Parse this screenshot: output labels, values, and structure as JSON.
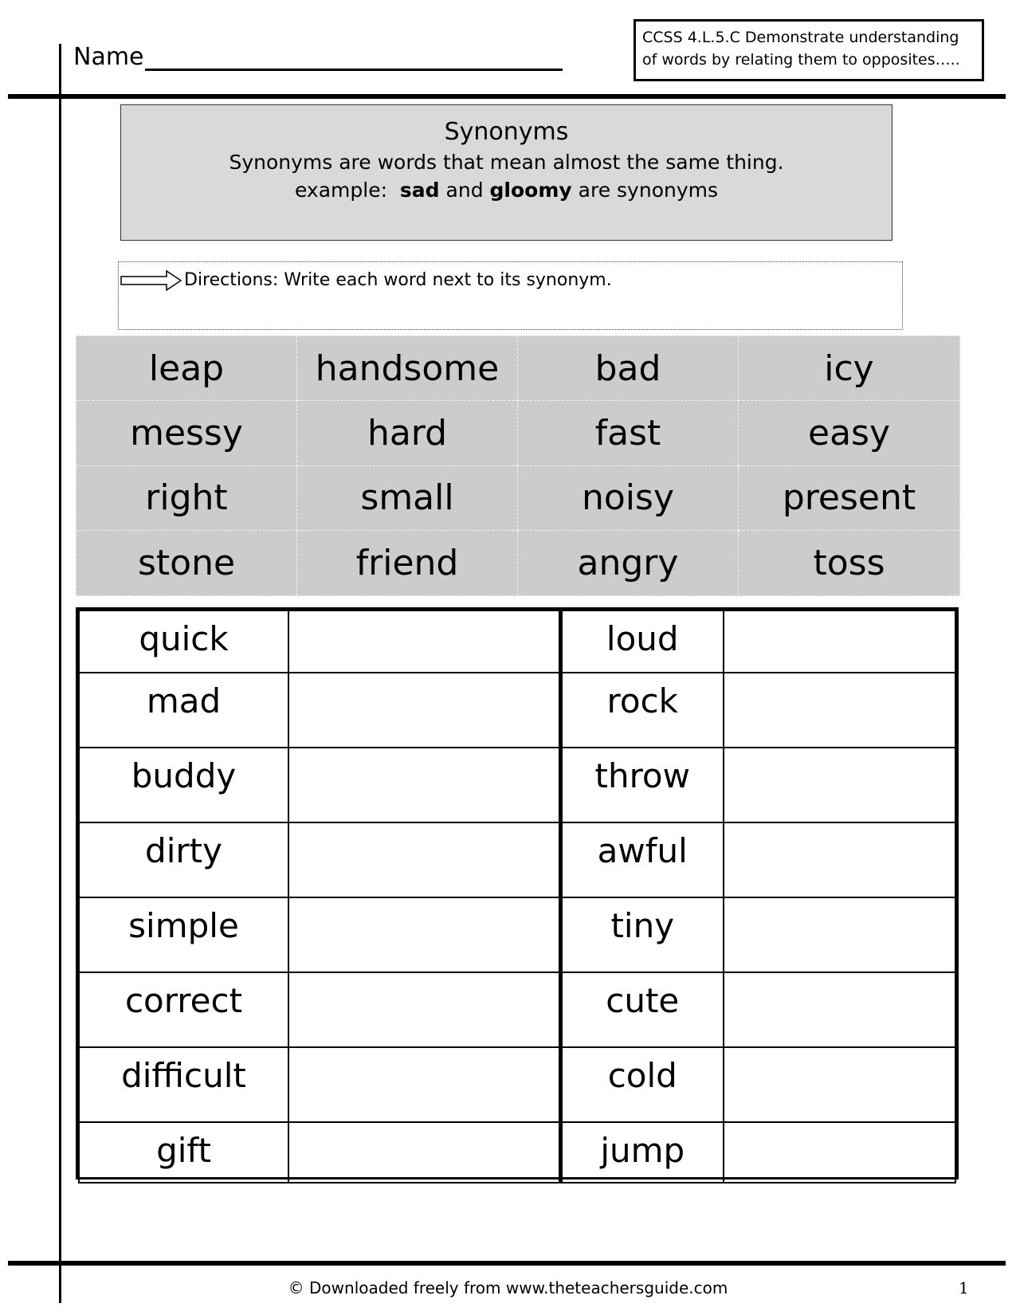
{
  "header": {
    "name_label": "Name",
    "standard": {
      "line1": "CCSS 4.L.5.C Demonstrate understanding",
      "line2": "of words by relating them to opposites….."
    }
  },
  "intro": {
    "title": "Synonyms",
    "definition": "Synonyms are words that mean almost the same thing.",
    "example_prefix": "example:",
    "example_word1": "sad",
    "example_and": "and",
    "example_word2": "gloomy",
    "example_suffix": "are synonyms"
  },
  "directions": {
    "icon": "arrow-right-icon",
    "text": "Directions: Write each word next to its synonym."
  },
  "word_bank": [
    [
      "leap",
      "handsome",
      "bad",
      "icy"
    ],
    [
      "messy",
      "hard",
      "fast",
      "easy"
    ],
    [
      "right",
      "small",
      "noisy",
      "present"
    ],
    [
      "stone",
      "friend",
      "angry",
      "toss"
    ]
  ],
  "answer_table": {
    "rows": [
      {
        "left": "quick",
        "right": "loud"
      },
      {
        "left": "mad",
        "right": "rock"
      },
      {
        "left": "buddy",
        "right": "throw"
      },
      {
        "left": "dirty",
        "right": "awful"
      },
      {
        "left": "simple",
        "right": "tiny"
      },
      {
        "left": "correct",
        "right": "cute"
      },
      {
        "left": "difficult",
        "right": "cold"
      },
      {
        "left": "gift",
        "right": "jump"
      }
    ]
  },
  "footer": {
    "credit": "© Downloaded freely from www.theteachersguide.com",
    "page_number": "1"
  },
  "colors": {
    "intro_bg": "#d9d9d9",
    "word_bank_bg": "#cccccc",
    "rule": "#000000"
  }
}
